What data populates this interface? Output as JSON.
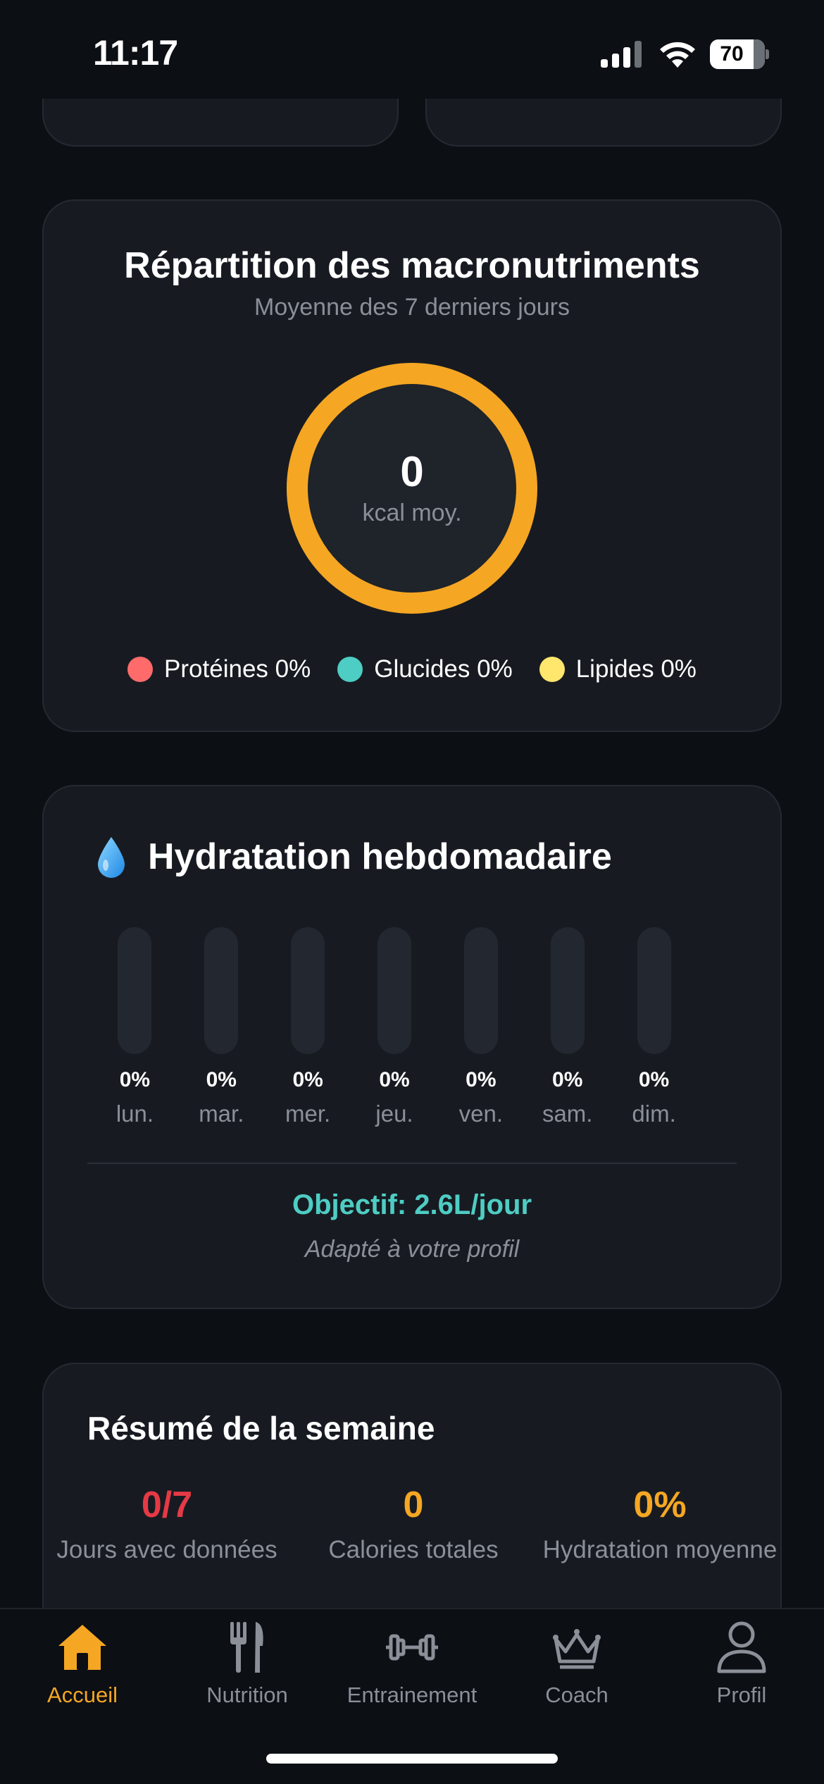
{
  "status_bar": {
    "time": "11:17",
    "battery": "70",
    "icons": [
      "signal-icon",
      "wifi-icon",
      "battery-icon"
    ]
  },
  "macro": {
    "title": "Répartition des macronutriments",
    "subtitle": "Moyenne des 7 derniers jours",
    "value": "0",
    "caption": "kcal moy.",
    "ring_color": "#f5a623",
    "legend": [
      {
        "label": "Protéines 0%",
        "color": "#ff6b6b"
      },
      {
        "label": "Glucides 0%",
        "color": "#4ecdc4"
      },
      {
        "label": "Lipides 0%",
        "color": "#ffe66d"
      }
    ]
  },
  "hydration": {
    "icon": "water-drop-icon",
    "title": "Hydratation hebdomadaire",
    "days": [
      {
        "day": "lun.",
        "percent_label": "0%",
        "fill": 0
      },
      {
        "day": "mar.",
        "percent_label": "0%",
        "fill": 0
      },
      {
        "day": "mer.",
        "percent_label": "0%",
        "fill": 0
      },
      {
        "day": "jeu.",
        "percent_label": "0%",
        "fill": 0
      },
      {
        "day": "ven.",
        "percent_label": "0%",
        "fill": 0
      },
      {
        "day": "sam.",
        "percent_label": "0%",
        "fill": 0
      },
      {
        "day": "dim.",
        "percent_label": "0%",
        "fill": 0
      }
    ],
    "goal": "Objectif: 2.6L/jour",
    "note": "Adapté à votre profil",
    "accent": "#4ecdc4"
  },
  "summary": {
    "title": "Résumé de la semaine",
    "stats": [
      {
        "value": "0/7",
        "label": "Jours avec données",
        "color": "#e63946"
      },
      {
        "value": "0",
        "label": "Calories totales",
        "color": "#f5a623"
      },
      {
        "value": "0%",
        "label": "Hydratation moyenne",
        "color": "#f5a623"
      }
    ]
  },
  "tab_bar": {
    "active_color": "#f5a623",
    "tabs": [
      {
        "label": "Accueil",
        "icon": "home-icon",
        "active": true
      },
      {
        "label": "Nutrition",
        "icon": "fork-knife-icon",
        "active": false
      },
      {
        "label": "Entrainement",
        "icon": "dumbbell-icon",
        "active": false
      },
      {
        "label": "Coach",
        "icon": "crown-icon",
        "active": false
      },
      {
        "label": "Profil",
        "icon": "person-icon",
        "active": false
      }
    ]
  }
}
